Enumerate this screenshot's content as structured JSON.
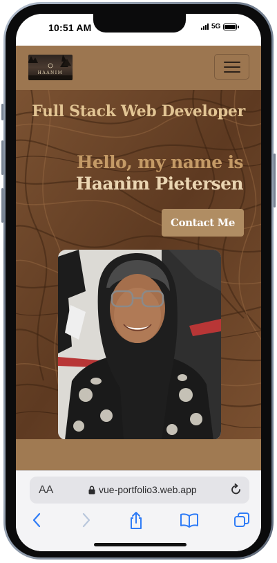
{
  "status_bar": {
    "time": "10:51 AM",
    "network": "5G"
  },
  "site": {
    "brand_text": "HAANIM",
    "subtitle": "Full Stack Web Developer",
    "greeting": "Hello, my name is",
    "name": "Haanim Pietersen",
    "contact_label": "Contact Me"
  },
  "browser": {
    "text_size_label": "AA",
    "url": "vue-portfolio3.web.app"
  },
  "icons": {
    "menu": "hamburger-menu-icon",
    "lock": "lock-icon",
    "reload": "reload-icon",
    "back": "back-arrow-icon",
    "forward": "forward-arrow-icon",
    "share": "share-icon",
    "bookmarks": "book-icon",
    "tabs": "tabs-icon"
  },
  "colors": {
    "navbar": "#9c7650",
    "heading": "#e2c594",
    "greeting": "#c49a66",
    "name": "#ead5b2",
    "button": "#b08d63",
    "browser_accent": "#2f7cf6"
  }
}
